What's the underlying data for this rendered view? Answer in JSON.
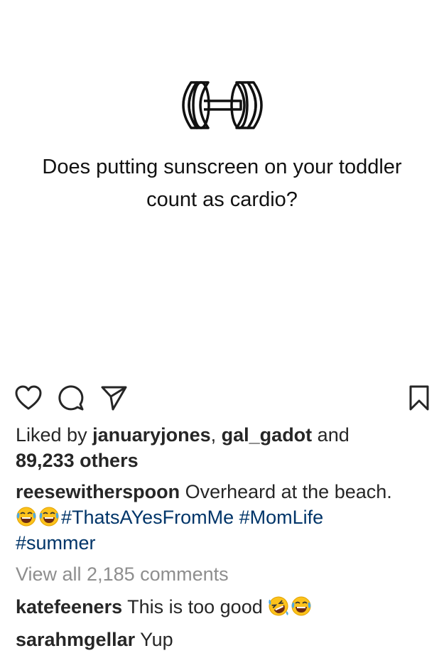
{
  "post": {
    "quote_line1": "Does putting sunscreen on your toddler",
    "quote_line2": "count as cardio?",
    "image_icon": "dumbbell-icon"
  },
  "actions": {
    "like_icon": "heart-icon",
    "comment_icon": "comment-bubble-icon",
    "share_icon": "paper-plane-icon",
    "save_icon": "bookmark-icon"
  },
  "likes": {
    "prefix": "Liked by ",
    "user1": "januaryjones",
    "separator": ", ",
    "user2": "gal_gadot",
    "and": " and",
    "others": "89,233 others"
  },
  "caption": {
    "username": "reesewitherspoon",
    "text": " Overheard at the beach.",
    "emojis": [
      "face-with-tears-of-joy",
      "face-with-tears-of-joy"
    ],
    "hashtag1": "#ThatsAYesFromMe",
    "hashtag2": "#MomLife",
    "hashtag3": "#summer"
  },
  "view_comments": "View all 2,185 comments",
  "comments": [
    {
      "username": "katefeeners",
      "text": " This is too good ",
      "emojis": [
        "rolling-on-the-floor-laughing",
        "face-with-tears-of-joy"
      ]
    },
    {
      "username": "sarahmgellar",
      "text": " Yup"
    }
  ],
  "colors": {
    "text": "#262626",
    "hashtag": "#003569",
    "muted": "#8e8e8e",
    "emoji_yellow": "#fcc21b",
    "emoji_tear": "#4fa8e0"
  }
}
